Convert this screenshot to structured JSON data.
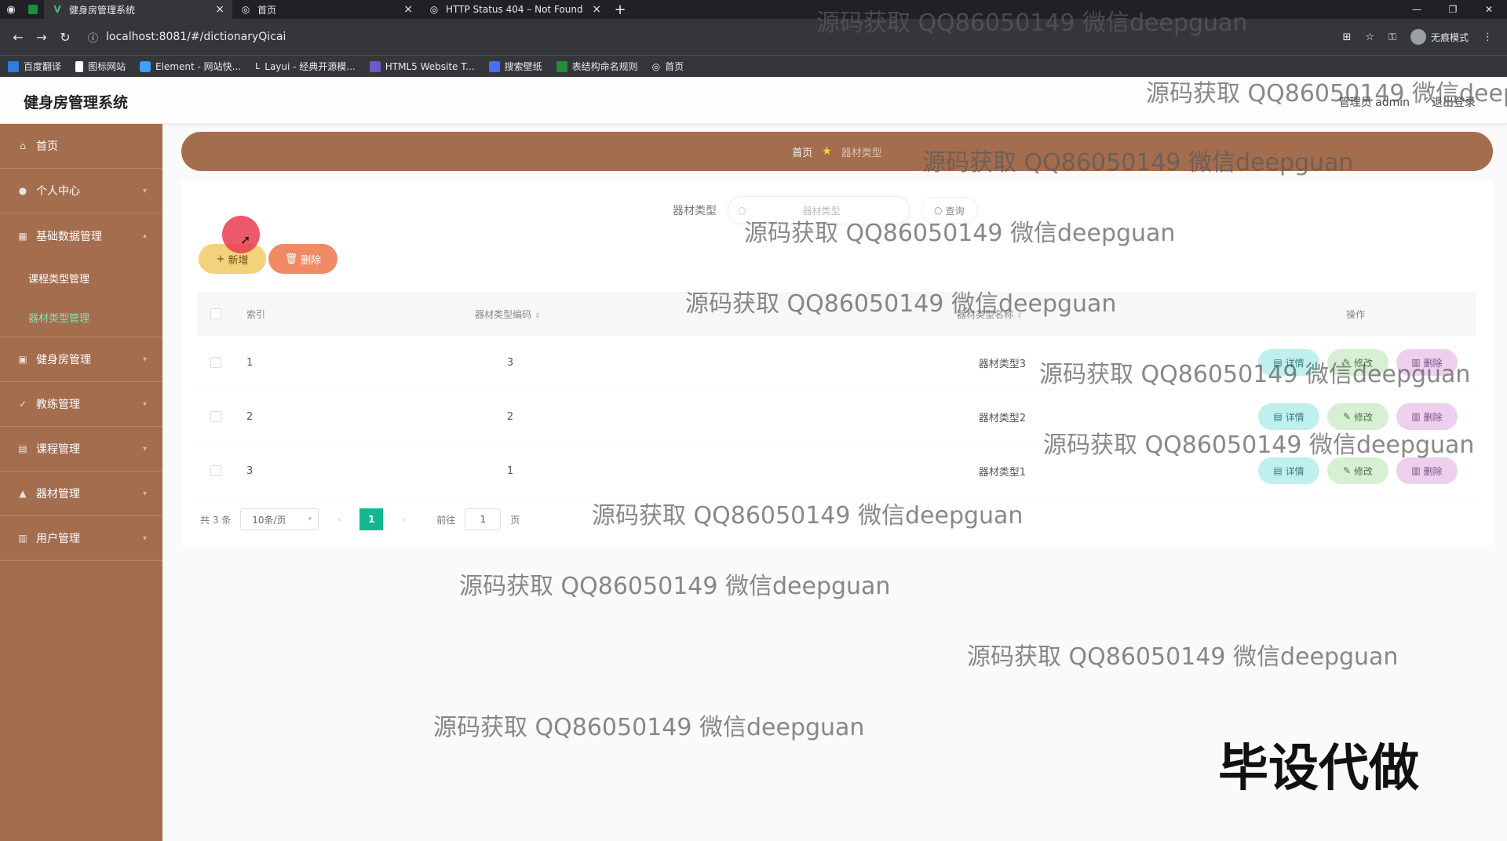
{
  "browser": {
    "tabs": [
      {
        "title": "健身房管理系统",
        "icon": "vue-v-icon",
        "active": true
      },
      {
        "title": "首页",
        "icon": "globe-icon",
        "active": false
      },
      {
        "title": "HTTP Status 404 – Not Found",
        "icon": "globe-icon",
        "active": false
      }
    ],
    "url": "localhost:8081/#/dictionaryQicai",
    "profile_label": "无痕模式",
    "bookmarks": [
      {
        "label": "百度翻译",
        "color": "#2f7be0"
      },
      {
        "label": "图标网站",
        "color": "#ffffff"
      },
      {
        "label": "Element - 网站快...",
        "color": "#409eff"
      },
      {
        "label": "Layui - 经典开源模...",
        "color": "#e8eaed"
      },
      {
        "label": "HTML5 Website T...",
        "color": "#6a5acd"
      },
      {
        "label": "搜索壁纸",
        "color": "#4a6cf7"
      },
      {
        "label": "表结构命名规则",
        "color": "#1e8e3e"
      },
      {
        "label": "首页",
        "color": "#e8eaed"
      }
    ]
  },
  "header": {
    "title": "健身房管理系统",
    "user": "管理员 admin",
    "logout": "退出登录"
  },
  "sidebar": {
    "items": [
      {
        "label": "首页",
        "icon": "home-icon"
      },
      {
        "label": "个人中心",
        "icon": "user-icon"
      },
      {
        "label": "基础数据管理",
        "icon": "grid-icon"
      },
      {
        "label": "健身房管理",
        "icon": "building-icon"
      },
      {
        "label": "教练管理",
        "icon": "whistle-icon"
      },
      {
        "label": "课程管理",
        "icon": "book-icon"
      },
      {
        "label": "器材管理",
        "icon": "dumbbell-icon"
      },
      {
        "label": "用户管理",
        "icon": "users-icon"
      }
    ],
    "subitems": [
      {
        "label": "课程类型管理",
        "active": false
      },
      {
        "label": "器材类型管理",
        "active": true
      }
    ]
  },
  "breadcrumb": {
    "home": "首页",
    "current": "器材类型"
  },
  "search": {
    "label": "器材类型",
    "placeholder": "器材类型",
    "button": "查询"
  },
  "toolbar": {
    "add_label": "新增",
    "delete_label": "删除"
  },
  "table": {
    "columns": {
      "index": "索引",
      "code": "器材类型编码",
      "name": "器材类型名称",
      "actions": "操作"
    },
    "rows": [
      {
        "index": "1",
        "code": "3",
        "name": "器材类型3"
      },
      {
        "index": "2",
        "code": "2",
        "name": "器材类型2"
      },
      {
        "index": "3",
        "code": "1",
        "name": "器材类型1"
      }
    ],
    "row_actions": {
      "detail": "详情",
      "edit": "修改",
      "delete": "删除"
    }
  },
  "pagination": {
    "total": "共 3 条",
    "page_size": "10条/页",
    "current_page": "1",
    "goto_prefix": "前往",
    "goto_value": "1",
    "goto_suffix": "页"
  },
  "watermarks": {
    "text": "源码获取 QQ86050149 微信deepguan",
    "header_clip": "源码获取 QQ86050149 微信deep",
    "big": "毕设代做"
  }
}
